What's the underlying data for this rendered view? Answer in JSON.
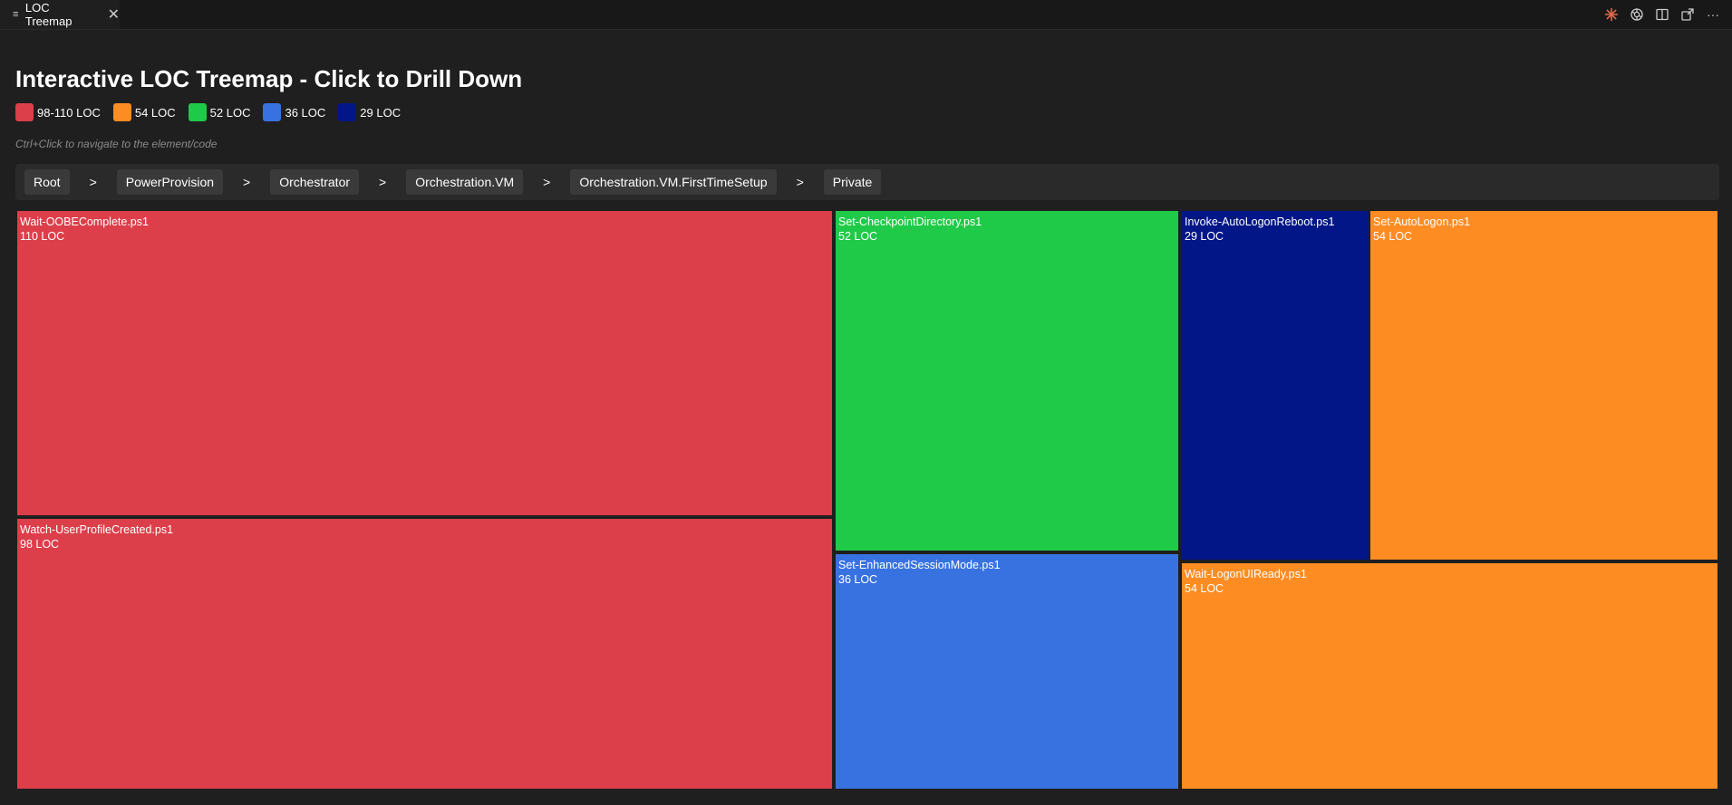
{
  "tab": {
    "label": "LOC Treemap",
    "close_glyph": "✕",
    "menu_icon": "list-icon"
  },
  "actions": [
    {
      "icon": "sparkle-icon",
      "color": "#e06c4a"
    },
    {
      "icon": "openai-icon",
      "color": "#cccccc"
    },
    {
      "icon": "split-editor-icon",
      "color": "#cccccc"
    },
    {
      "icon": "open-external-icon",
      "color": "#cccccc"
    },
    {
      "icon": "more-icon",
      "label": "···",
      "color": "#cccccc"
    }
  ],
  "title": "Interactive LOC Treemap - Click to Drill Down",
  "legend": [
    {
      "label": "98-110 LOC",
      "color": "#dc3e4a"
    },
    {
      "label": "54 LOC",
      "color": "#fd8c22"
    },
    {
      "label": "52 LOC",
      "color": "#1fca48"
    },
    {
      "label": "36 LOC",
      "color": "#3872e0"
    },
    {
      "label": "29 LOC",
      "color": "#021687"
    }
  ],
  "hint": "Ctrl+Click to navigate to the element/code",
  "breadcrumb": [
    "Root",
    "PowerProvision",
    "Orchestrator",
    "Orchestration.VM",
    "Orchestration.VM.FirstTimeSetup",
    "Private"
  ],
  "breadcrumb_separator": ">",
  "treemap": [
    {
      "name": "Wait-OOBEComplete.ps1",
      "loc": "110 LOC",
      "color": "#dc3e4a"
    },
    {
      "name": "Watch-UserProfileCreated.ps1",
      "loc": "98 LOC",
      "color": "#dc3e4a"
    },
    {
      "name": "Set-CheckpointDirectory.ps1",
      "loc": "52 LOC",
      "color": "#1fca48"
    },
    {
      "name": "Set-EnhancedSessionMode.ps1",
      "loc": "36 LOC",
      "color": "#3872e0"
    },
    {
      "name": "Invoke-AutoLogonReboot.ps1",
      "loc": "29 LOC",
      "color": "#021687"
    },
    {
      "name": "Set-AutoLogon.ps1",
      "loc": "54 LOC",
      "color": "#fd8c22"
    },
    {
      "name": "Wait-LogonUIReady.ps1",
      "loc": "54 LOC",
      "color": "#fd8c22"
    }
  ]
}
